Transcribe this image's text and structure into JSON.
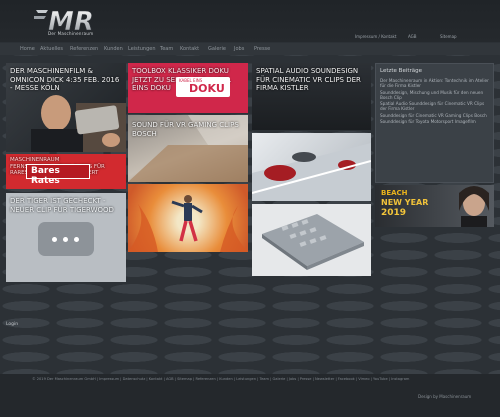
{
  "header": {
    "logo_text": "MR",
    "tagline": "Der Maschinenraum",
    "util_links": [
      "Impressum / Kontakt",
      "AGB",
      "Sitemap"
    ]
  },
  "nav": {
    "items": [
      "Home",
      "Aktuelles",
      "Referenzen",
      "Kunden",
      "Leistungen",
      "Team",
      "Kontakt",
      "Galerie",
      "Jobs",
      "Presse"
    ]
  },
  "tiles": {
    "maschinenfilm": "Der Maschinenfilm & Omnicon Dick 4:35 Feb. 2016 - Messe Köln",
    "doku_caption": "Toolbox Klassiker DOKU jetzt zu sehen auf Kabel Eins Doku",
    "doku_logo_prefix": "KABEL EINS",
    "doku_logo": "DOKU",
    "spatial": "Spatial Audio Soundesign für Cinematic VR Clips der Firma Kistler",
    "sound_vr": "Sound für VR Gaming Clips BOSCH",
    "bares": "Bares Rates",
    "bares_caption": "Maschinenraum Fernsehproduktion Bares für Rares Frei Digital Lizensiert",
    "tiger": "Der Tiger ist gecheckt - neuer Clip für Tigerwood",
    "more_icon": "ellipsis-icon"
  },
  "sidebar": {
    "title": "Letzte Beiträge",
    "items": [
      "Der Maschinenraum in Aktion: Tontechnik im Atelier für die Firma Kistler",
      "Sounddesign, Mischung und Musik für den neuen Bosch Clip",
      "Spatial Audio Sounddesign für Cinematic VR Clips der Firma Kistler",
      "Sounddesign für Cinematic VR Gaming Clips Bosch",
      "Sounddesign für Toyota Motorsport Imagefilm"
    ]
  },
  "promo": {
    "line1": "BEACH",
    "line2": "NEW YEAR",
    "line3": "2019"
  },
  "misc": {
    "login_text": "Login"
  },
  "footer": {
    "links": "© 2019 Der Maschinenraum GmbH | Impressum | Datenschutz | Kontakt | AGB | Sitemap | Referenzen | Kunden | Leistungen | Team | Galerie | Jobs | Presse | Newsletter | Facebook | Vimeo | YouTube | Instagram",
    "right": "Design by Maschinenraum"
  },
  "colors": {
    "accent_red": "#d0274a",
    "bg": "#2b3035",
    "sidebar": "#3b4147"
  }
}
